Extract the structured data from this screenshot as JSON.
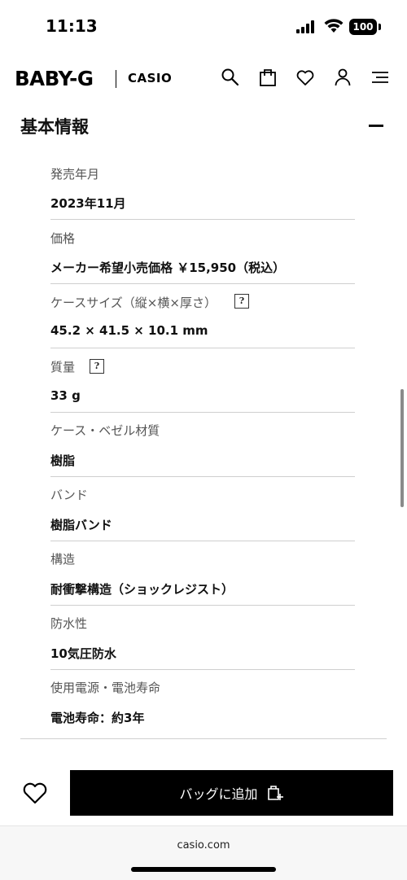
{
  "status_bar": {
    "time": "11:13",
    "battery": "100"
  },
  "header": {
    "brand": "BABY-G",
    "sub_brand": "CASIO",
    "icons": [
      "search-icon",
      "bag-icon",
      "heart-icon",
      "account-icon",
      "menu-icon"
    ]
  },
  "section": {
    "title": "基本情報"
  },
  "specs": [
    {
      "label": "発売年月",
      "value": "2023年11月"
    },
    {
      "label": "価格",
      "value": "メーカー希望小売価格 ￥15,950（税込）"
    },
    {
      "label": "ケースサイズ（縦×横×厚さ）",
      "value": "45.2 × 41.5 × 10.1 mm",
      "help": "?"
    },
    {
      "label": "質量",
      "value": "33 g",
      "help": "?"
    },
    {
      "label": "ケース・ベゼル材質",
      "value": "樹脂"
    },
    {
      "label": "バンド",
      "value": "樹脂バンド"
    },
    {
      "label": "構造",
      "value": "耐衝撃構造（ショックレジスト）"
    },
    {
      "label": "防水性",
      "value": "10気圧防水"
    },
    {
      "label": "使用電源・電池寿命",
      "value": "電池寿命：約3年"
    }
  ],
  "bottom_bar": {
    "add_to_bag_label": "バッグに追加"
  },
  "browser": {
    "url": "casio.com"
  },
  "colors": {
    "button_bg": "#000000",
    "divider": "#cfcfcf",
    "label": "#555555"
  }
}
